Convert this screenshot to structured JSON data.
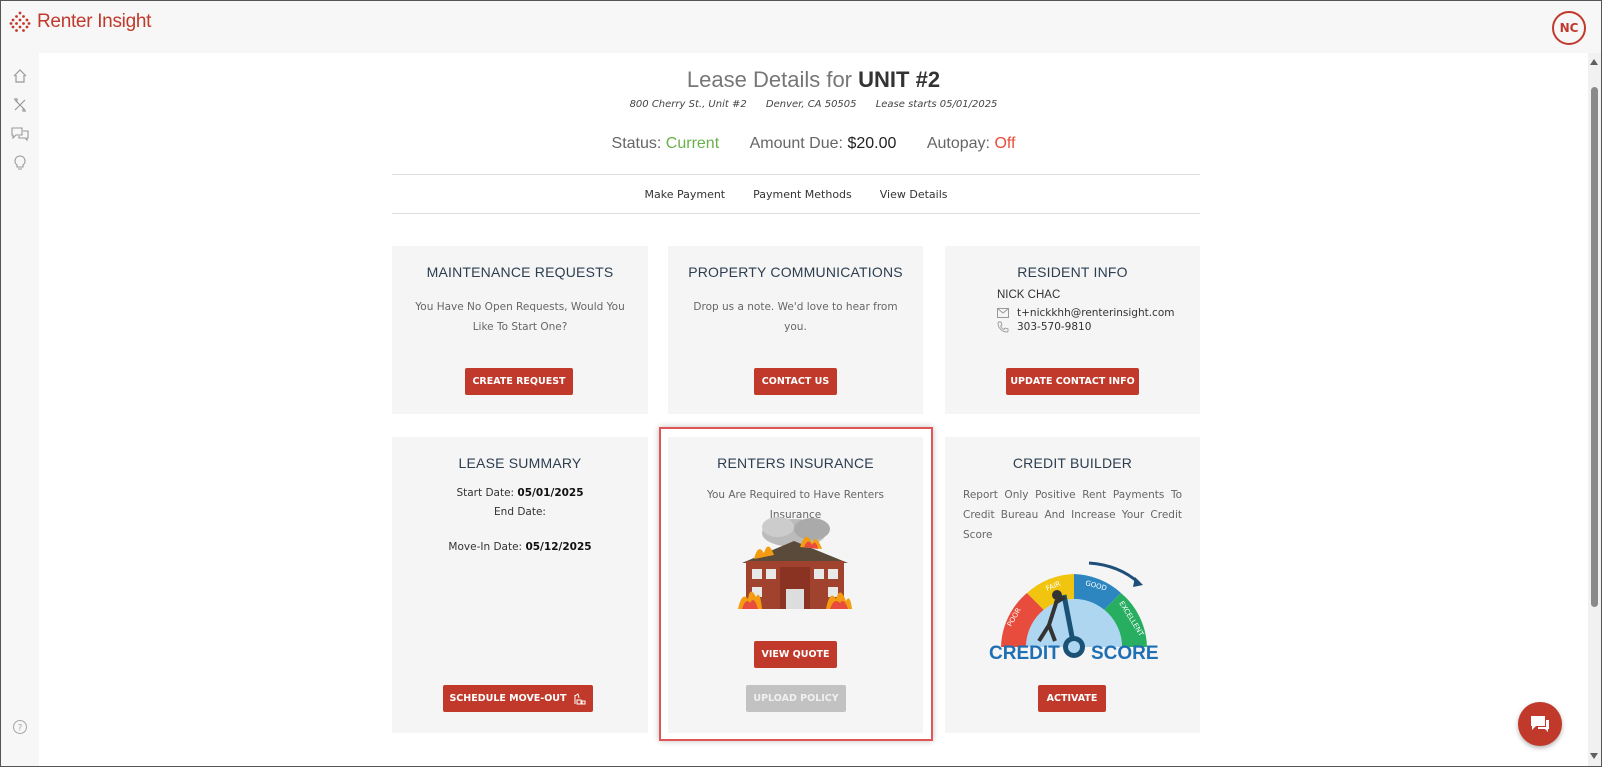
{
  "app": {
    "logo_text": "Renter Insight",
    "user_initials": "NC"
  },
  "header": {
    "title_prefix": "Lease Details for",
    "title_unit": "UNIT #2",
    "address": "800 Cherry St., Unit #2",
    "city": "Denver, CA 50505",
    "lease_start": "Lease starts 05/01/2025"
  },
  "status": {
    "status_label": "Status:",
    "status_value": "Current",
    "amount_label": "Amount Due:",
    "amount_value": "$20.00",
    "autopay_label": "Autopay:",
    "autopay_value": "Off"
  },
  "nav": {
    "make_payment": "Make Payment",
    "payment_methods": "Payment Methods",
    "view_details": "View Details"
  },
  "cards": {
    "maintenance": {
      "title": "MAINTENANCE REQUESTS",
      "text": "You Have No Open Requests, Would You Like To Start One?",
      "button": "CREATE REQUEST"
    },
    "communications": {
      "title": "PROPERTY COMMUNICATIONS",
      "text": "Drop us a note. We'd love to hear from you.",
      "button": "CONTACT US"
    },
    "resident": {
      "title": "RESIDENT INFO",
      "name": "NICK CHAC",
      "email": "t+nickkhh@renterinsight.com",
      "phone": "303-570-9810",
      "button": "UPDATE CONTACT INFO"
    },
    "lease": {
      "title": "LEASE SUMMARY",
      "start_label": "Start Date:",
      "start_value": "05/01/2025",
      "end_label": "End Date:",
      "movein_label": "Move-In Date:",
      "movein_value": "05/12/2025",
      "button": "SCHEDULE MOVE-OUT"
    },
    "insurance": {
      "title": "RENTERS INSURANCE",
      "text": "You Are Required to Have Renters Insurance",
      "button_quote": "VIEW QUOTE",
      "button_upload": "UPLOAD POLICY"
    },
    "credit": {
      "title": "CREDIT BUILDER",
      "text": "Report Only Positive Rent Payments To Credit Bureau And Increase Your Credit Score",
      "gauge": {
        "poor": "POOR",
        "fair": "FAIR",
        "good": "GOOD",
        "excellent": "EXCELLENT",
        "credit": "CREDIT",
        "score": "SCORE"
      },
      "button": "ACTIVATE"
    }
  },
  "colors": {
    "brand": "#c0392b",
    "status_green": "#6ab04c",
    "autopay_red": "#e74c3c",
    "highlight": "#e05656"
  }
}
